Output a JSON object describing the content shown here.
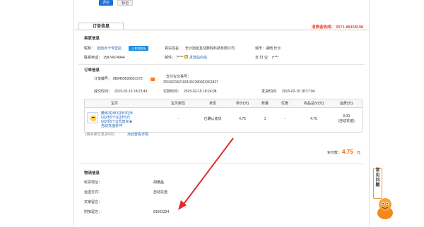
{
  "toolbar": {
    "btn1": "评价",
    "btn2": "标记"
  },
  "hotline": "消费者热线： 0571-88158198",
  "tab_label": "订单信息",
  "seller": {
    "title": "卖家信息",
    "nick_label": "昵称：",
    "nick_value": "旭旭点卡专营店",
    "badge_label": "和我联系",
    "realname_label": "真实姓名：",
    "realname_value": "长沙旭旭互动数码科技有限公司",
    "city_label": "城市：",
    "city_value": "湖南 长沙",
    "phone_label": "联系电话：",
    "phone_value": "15874974944",
    "email_label": "邮件：",
    "email_value": "7****",
    "email_link": "发送站内信",
    "alipay_label": "支 付 宝：",
    "alipay_value": "r****"
  },
  "order": {
    "title": "订单信息",
    "order_no_label": "订单编号：",
    "order_no_value": "880459509601573",
    "alipay_trade_label": "支付宝交易号：",
    "alipay_trade_value": "2015021521001001390023361827",
    "created_label": "成交时间：",
    "created_value": "2015-02-15 18:23:43",
    "paid_label": "付款时间：",
    "paid_value": "2015-02-15 18:24:08",
    "shipped_label": "发货时间：",
    "shipped_value": "2015-02-15 18:27:04",
    "columns": [
      "宝贝",
      "宝贝属性",
      "状态",
      "单价(元)",
      "数量",
      "优惠",
      "商品总价(元)",
      "运费(元)"
    ],
    "item": {
      "name": "腾讯3Q币3Q币3Q币QQ币5个QQ币5元QQ币5个Q币直充★自动充值秒冲",
      "attr": "-",
      "status": "已确认收货",
      "price": "4.75",
      "qty": "1",
      "discount": "-",
      "total": "4.75",
      "shipping": "0.00",
      "shipping_note": "(自动充值)"
    },
    "note": "(待买家已发货9次)",
    "note_link": "点此查看详情",
    "paid_total_label": "实付款：",
    "paid_total_value": "4.75",
    "paid_total_unit": "元"
  },
  "logistics": {
    "title": "物流信息",
    "addr_label": "收货地址：",
    "addr_value": "胡珊晶",
    "method_label": "运送方式：",
    "method_value": "自动充值",
    "msg_label": "买家留言：",
    "msg_value": "",
    "extra_label": "附加留言：",
    "extra_value": "81603324"
  },
  "float_button": "常见问题",
  "colors": {
    "hotline": "#e8442f",
    "link": "#1b5fbb",
    "price": "#f56a12",
    "arrow": "#e52b2b"
  }
}
